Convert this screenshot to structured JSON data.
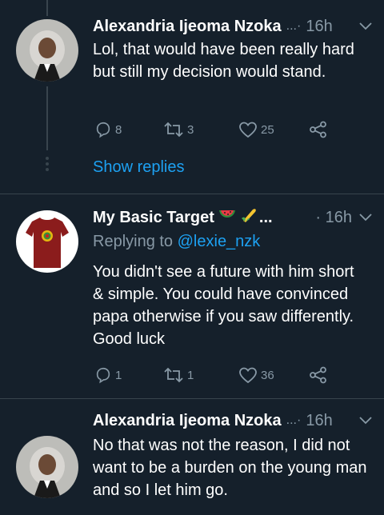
{
  "tweets": [
    {
      "author": "Alexandria Ijeoma Nzoka",
      "name_ellipsis": "...·",
      "time": "16h",
      "body": "Lol, that would have been really hard but still my decision would stand.",
      "reply_count": "8",
      "retweet_count": "3",
      "like_count": "25",
      "show_replies": "Show replies"
    },
    {
      "author": "My Basic Target",
      "name_ellipsis": "...",
      "time": "· 16h",
      "replying_prefix": "Replying to",
      "replying_handle": "@lexie_nzk",
      "body": "You didn't see a future with him short & simple. You could have convinced papa otherwise if you saw differently. Good luck",
      "reply_count": "1",
      "retweet_count": "1",
      "like_count": "36"
    },
    {
      "author": "Alexandria Ijeoma Nzoka",
      "name_ellipsis": "...·",
      "time": "16h",
      "body": "No that was not the reason, I did not want to be a burden on the young man and so I let him go."
    }
  ],
  "icons": {
    "reply": "reply-icon",
    "retweet": "retweet-icon",
    "like": "like-icon",
    "share": "share-icon",
    "caret": "chevron-down-icon",
    "emoji1": "watermelon-emoji-icon",
    "emoji2": "corn-emoji-icon"
  },
  "colors": {
    "background": "#15202b",
    "text": "#ffffff",
    "secondary": "#8899a6",
    "accent": "#1da1f2",
    "border": "#38444d"
  }
}
